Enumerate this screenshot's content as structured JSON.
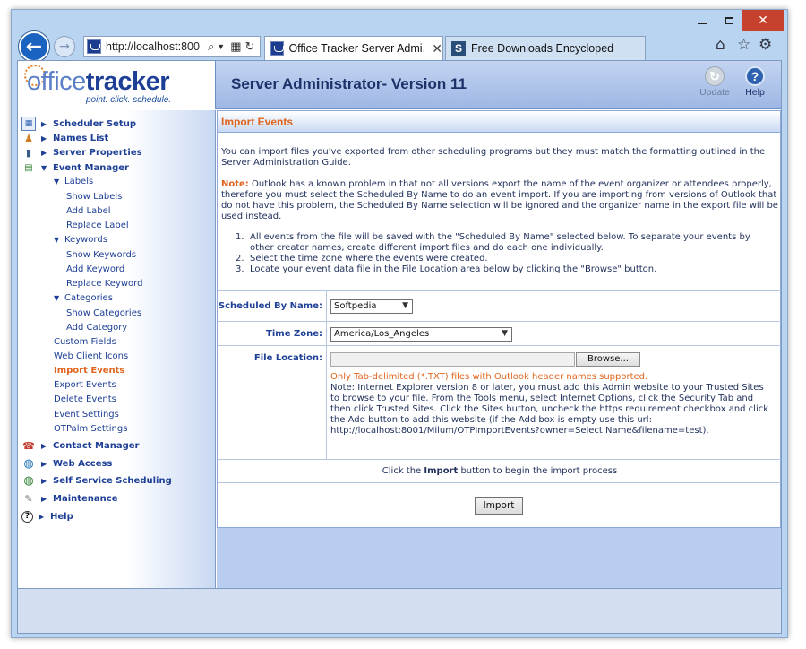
{
  "browser": {
    "address_url": "http://localhost:800",
    "tabs": [
      {
        "label": "Office Tracker Server Admi..."
      },
      {
        "label": "Free Downloads Encyclopedia"
      }
    ]
  },
  "header": {
    "logo_light": "office",
    "logo_bold": "tracker",
    "tagline": "point. click. schedule.",
    "title": "Server Administrator- Version 11",
    "update_label": "Update",
    "help_label": "Help"
  },
  "sidebar": {
    "scheduler_setup": "Scheduler Setup",
    "names_list": "Names List",
    "server_properties": "Server Properties",
    "event_manager": "Event Manager",
    "labels": "Labels",
    "show_labels": "Show Labels",
    "add_label": "Add Label",
    "replace_label": "Replace Label",
    "keywords": "Keywords",
    "show_keywords": "Show Keywords",
    "add_keyword": "Add Keyword",
    "replace_keyword": "Replace Keyword",
    "categories": "Categories",
    "show_categories": "Show Categories",
    "add_category": "Add Category",
    "custom_fields": "Custom Fields",
    "web_client_icons": "Web Client Icons",
    "import_events": "Import Events",
    "export_events": "Export Events",
    "delete_events": "Delete Events",
    "event_settings": "Event Settings",
    "otpalm_settings": "OTPalm Settings",
    "contact_manager": "Contact Manager",
    "web_access": "Web Access",
    "self_service_scheduling": "Self Service Scheduling",
    "maintenance": "Maintenance",
    "help": "Help"
  },
  "panel": {
    "title": "Import Events",
    "intro": "You can import files you've exported from other scheduling programs but they must match the formatting outlined in the Server Administration Guide.",
    "note_label": "Note:",
    "note_text": " Outlook has a known problem in that not all versions export the name of the event organizer or attendees properly, therefore you must select the Scheduled By Name to do an event import. If you are importing from versions of Outlook that do not have this problem, the Scheduled By Name selection will be ignored and the organizer name in the export file will be used instead.",
    "steps": [
      "All events from the file will be saved with the \"Scheduled By Name\" selected below. To separate your events by other creator names, create different import files and do each one individually.",
      "Select the time zone where the events were created.",
      "Locate your event data file in the File Location area below by clicking the \"Browse\" button."
    ],
    "scheduled_by_label": "Scheduled By Name:",
    "scheduled_by_value": "Softpedia",
    "time_zone_label": "Time Zone:",
    "time_zone_value": "America/Los_Angeles",
    "file_location_label": "File Location:",
    "browse_label": "Browse...",
    "file_note": "Only Tab-delimited (*.TXT) files with Outlook header names supported.",
    "ie_note": "Note: Internet Explorer version 8 or later, you must add this Admin website to your Trusted Sites to browse to your file. From the Tools menu, select Internet Options, click the Security Tab and then click Trusted Sites. Click the Sites button, uncheck the https requirement checkbox and click the Add button to add this website (if the Add box is empty use this url: http://localhost:8001/Milum/OTPImportEvents?owner=Select Name&filename=test).",
    "click_pre": "Click the ",
    "click_bold": "Import",
    "click_post": " button to begin the import process",
    "import_button": "Import"
  }
}
